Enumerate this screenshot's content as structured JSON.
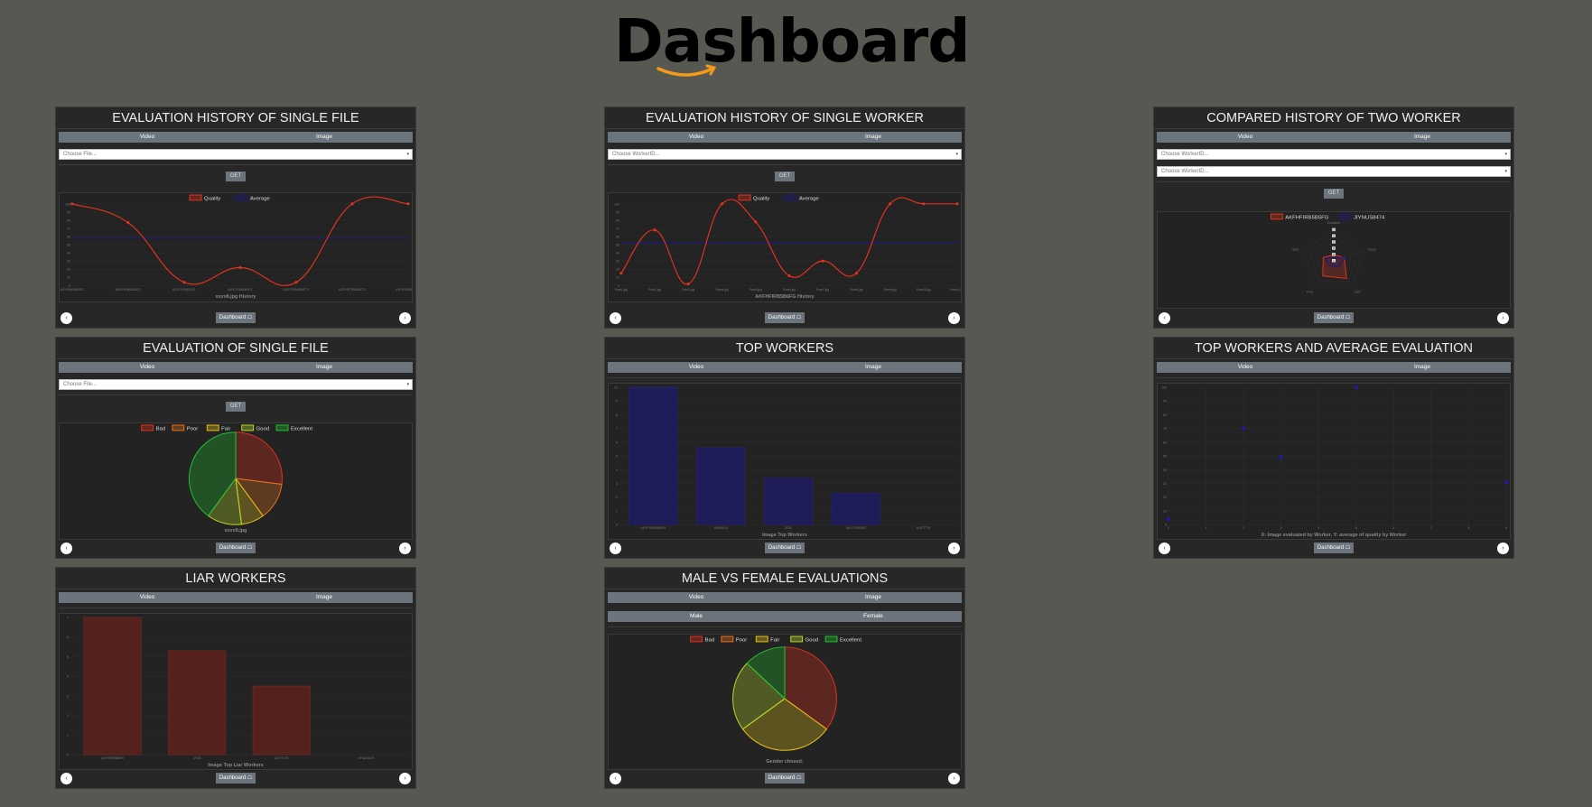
{
  "header": {
    "logo_text": "Dashboard"
  },
  "common": {
    "video_label": "Video",
    "image_label": "Image",
    "get_label": "GET",
    "dashboard_label": "Dashboard ☖",
    "prev_arrow": "‹",
    "next_arrow": "›",
    "select_arrow": "▾"
  },
  "panels": {
    "p1": {
      "title": "EVALUATION HISTORY OF SINGLE FILE",
      "select_placeholder": "Choose File..."
    },
    "p2": {
      "title": "EVALUATION HISTORY OF SINGLE WORKER",
      "select_placeholder": "Choose WorkerID..."
    },
    "p3": {
      "title": "COMPARED HISTORY OF TWO WORKER",
      "select1_placeholder": "Choose WorkerID...",
      "select2_placeholder": "Choose WorkerID..."
    },
    "p4": {
      "title": "EVALUATION OF SINGLE FILE",
      "select_placeholder": "Choose File..."
    },
    "p5": {
      "title": "TOP WORKERS"
    },
    "p6": {
      "title": "TOP WORKERS AND AVERAGE EVALUATION"
    },
    "p7": {
      "title": "LIAR WORKERS"
    },
    "p8": {
      "title": "MALE VS FEMALE EVALUATIONS",
      "male_label": "Male",
      "female_label": "Female"
    }
  },
  "colors": {
    "quality": "#e0321e",
    "average": "#1c1a78",
    "bar_blue": "#1f1c5a",
    "bar_red": "#55211c",
    "bad": "#e0321e",
    "poor": "#e5731b",
    "fair": "#e5c21b",
    "good": "#b9d92a",
    "excellent": "#22c22f"
  },
  "chart_data": [
    {
      "id": "file-history",
      "type": "line",
      "title": "xxxx8.jpg History",
      "legend": [
        "Quality",
        "Average"
      ],
      "legend_position": "top",
      "categories": [
        "A4FHRIN5B5E6TL",
        "A4EFHRIN5B5E6TL",
        "A1CPJVFNDE6TL",
        "A4FHTVN5B5E6TL",
        "A3EFFDRN5B5EFTL",
        "A1EFHRTRN5BEDTL",
        "A3FHFRN5B5E6TL"
      ],
      "series": [
        {
          "name": "Quality",
          "values": [
            100,
            77,
            4,
            22,
            4,
            100,
            100
          ]
        },
        {
          "name": "Average",
          "values": [
            58,
            58,
            58,
            58,
            58,
            58,
            58
          ]
        }
      ],
      "ylim": [
        0,
        100
      ],
      "yticks": [
        "0",
        "10",
        "20",
        "30",
        "40",
        "50",
        "60",
        "70",
        "80",
        "90",
        "100"
      ]
    },
    {
      "id": "worker-history",
      "type": "line",
      "title": "AKFHFIRB5B6FG History",
      "legend": [
        "Quality",
        "Average"
      ],
      "legend_position": "top",
      "categories": [
        "Pose1.jpg",
        "Pose2.jpg",
        "Pose3.jpg",
        "Pose4.jpg",
        "Pose5.jpg",
        "Pose6.jpg",
        "Pose7.jpg",
        "Pose8.jpg",
        "Pose9.jpg",
        "Pose10.jpg",
        "Pose11.jpg"
      ],
      "series": [
        {
          "name": "Quality",
          "values": [
            15,
            68,
            2,
            100,
            78,
            12,
            30,
            15,
            100,
            100,
            100
          ]
        },
        {
          "name": "Average",
          "values": [
            52,
            52,
            52,
            52,
            52,
            52,
            52,
            52,
            52,
            52,
            52
          ]
        }
      ],
      "ylim": [
        0,
        100
      ],
      "yticks": [
        "0",
        "10",
        "20",
        "30",
        "40",
        "50",
        "60",
        "70",
        "80",
        "90",
        "100"
      ]
    },
    {
      "id": "compare-two",
      "type": "radar",
      "legend": [
        "AKFHFIRB5B5FG",
        "JIYNUS8474"
      ],
      "legend_position": "top",
      "labels": [
        "Excellent",
        "Good",
        "Fair",
        "Poor",
        "Bad"
      ],
      "series": [
        {
          "name": "AKFHFIRB5B5FG",
          "values": [
            20,
            35,
            70,
            60,
            35
          ]
        },
        {
          "name": "JIYNUS8474",
          "values": [
            10,
            40,
            25,
            20,
            30
          ]
        }
      ],
      "ylim": [
        0,
        100
      ]
    },
    {
      "id": "single-file-pie",
      "type": "pie",
      "title": "xxxx8.jpg",
      "legend": [
        "Bad",
        "Poor",
        "Fair",
        "Good",
        "Excellent"
      ],
      "legend_position": "top",
      "values": [
        27,
        13,
        8,
        12,
        40
      ]
    },
    {
      "id": "top-workers",
      "type": "bar",
      "xlabel": "Image Top Workers",
      "categories": [
        "A4FHTRNB5B6F6S",
        "JIHUS8474",
        "ZFG5",
        "AHLSTS96S6S",
        "ALR7T7TA"
      ],
      "values": [
        10,
        5.6,
        3.4,
        2.3,
        0
      ],
      "ylim": [
        0,
        10
      ],
      "yticks": [
        "0",
        "1",
        "2",
        "3",
        "4",
        "5",
        "6",
        "7",
        "8",
        "9",
        "10"
      ]
    },
    {
      "id": "top-workers-scatter",
      "type": "scatter",
      "xlabel": "X: Image evaluated by Worker, Y: average of quality by Worker",
      "points": [
        {
          "x": 0,
          "y": 4
        },
        {
          "x": 2,
          "y": 70
        },
        {
          "x": 3,
          "y": 49
        },
        {
          "x": 5,
          "y": 100
        },
        {
          "x": 9,
          "y": 31
        }
      ],
      "xlim": [
        0,
        9
      ],
      "ylim": [
        0,
        100
      ],
      "xticks": [
        "0",
        "1",
        "2",
        "3",
        "4",
        "5",
        "6",
        "7",
        "8",
        "9"
      ],
      "yticks": [
        "0",
        "10",
        "20",
        "30",
        "40",
        "50",
        "60",
        "70",
        "80",
        "90",
        "100"
      ]
    },
    {
      "id": "liar-workers",
      "type": "bar",
      "xlabel": "Image Top Liar Workers",
      "categories": [
        "A4FHFIRB5B6F6",
        "ZFG5",
        "ALR7T7TA",
        "JIYNUS8474"
      ],
      "values": [
        7,
        5.3,
        3.5,
        0
      ],
      "ylim": [
        0,
        7
      ],
      "yticks": [
        "0",
        "1",
        "2",
        "3",
        "4",
        "5",
        "6",
        "7"
      ]
    },
    {
      "id": "gender-pie",
      "type": "pie",
      "title": "Gender chosed:",
      "legend": [
        "Bad",
        "Poor",
        "Fair",
        "Good",
        "Excellent"
      ],
      "legend_position": "top",
      "values": [
        35,
        0,
        30,
        22,
        13
      ]
    }
  ]
}
